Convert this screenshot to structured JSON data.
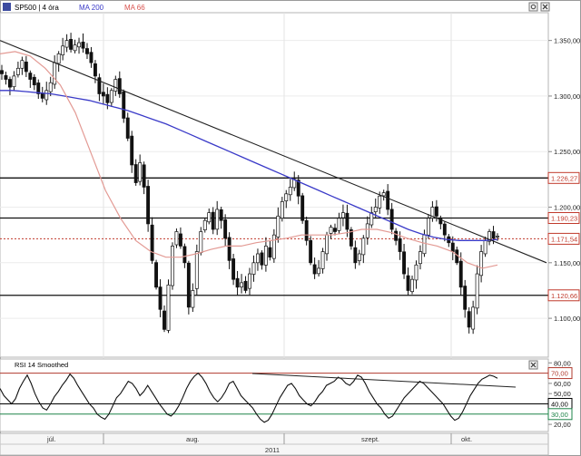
{
  "header": {
    "symbol": "SP500 | 4 óra",
    "ma200": "MA 200",
    "ma66": "MA 66",
    "colors": {
      "ma200": "#3a3ac8",
      "ma66": "#d9534f",
      "price": "#000000"
    }
  },
  "rsi_header": {
    "label": "RSI 14 Smoothed"
  },
  "time_axis": {
    "months": [
      "júl.",
      "aug.",
      "szept.",
      "okt."
    ],
    "year": "2011"
  },
  "icons": {
    "settings": "gear-icon",
    "close": "close-icon"
  },
  "chart_data": [
    {
      "type": "candlestick",
      "title": "SP500 | 4 óra",
      "ylim": [
        1065,
        1375
      ],
      "yticks": [
        "1.350,00",
        "1.300,00",
        "1.250,00",
        "1.200,00",
        "1.150,00",
        "1.100,00"
      ],
      "ytick_values": [
        1350,
        1300,
        1250,
        1200,
        1150,
        1100
      ],
      "levels": [
        {
          "label": "1.226,27",
          "value": 1226.27,
          "color": "#c0392b",
          "style": "solid"
        },
        {
          "label": "1.190,23",
          "value": 1190.23,
          "color": "#c0392b",
          "style": "solid"
        },
        {
          "label": "1.171,54",
          "value": 1171.54,
          "color": "#c0392b",
          "style": "dotted"
        },
        {
          "label": "1.120,66",
          "value": 1120.66,
          "color": "#c0392b",
          "style": "solid"
        }
      ],
      "price_close": [
        1320,
        1315,
        1308,
        1318,
        1325,
        1332,
        1322,
        1315,
        1310,
        1302,
        1298,
        1305,
        1312,
        1330,
        1338,
        1345,
        1350,
        1342,
        1346,
        1348,
        1343,
        1338,
        1330,
        1318,
        1302,
        1300,
        1294,
        1305,
        1315,
        1302,
        1280,
        1262,
        1238,
        1222,
        1240,
        1218,
        1185,
        1152,
        1128,
        1108,
        1090,
        1130,
        1165,
        1178,
        1165,
        1150,
        1110,
        1125,
        1160,
        1178,
        1188,
        1195,
        1180,
        1198,
        1188,
        1172,
        1152,
        1135,
        1128,
        1132,
        1125,
        1140,
        1150,
        1158,
        1148,
        1165,
        1155,
        1175,
        1192,
        1205,
        1212,
        1218,
        1225,
        1210,
        1188,
        1170,
        1150,
        1140,
        1145,
        1160,
        1175,
        1182,
        1178,
        1190,
        1195,
        1180,
        1165,
        1150,
        1158,
        1172,
        1185,
        1195,
        1200,
        1210,
        1213,
        1198,
        1180,
        1170,
        1160,
        1140,
        1125,
        1135,
        1148,
        1160,
        1175,
        1190,
        1200,
        1192,
        1185,
        1175,
        1168,
        1160,
        1150,
        1128,
        1108,
        1092,
        1110,
        1140,
        1160,
        1170,
        1178,
        1172,
        1174
      ],
      "ma200": [
        1305,
        1305,
        1304,
        1303,
        1302,
        1300,
        1298,
        1296,
        1293,
        1290,
        1287,
        1283,
        1279,
        1275,
        1270,
        1265,
        1260,
        1255,
        1250,
        1245,
        1240,
        1235,
        1230,
        1225,
        1220,
        1215,
        1210,
        1205,
        1200,
        1195,
        1190,
        1185,
        1180,
        1176,
        1173,
        1171,
        1170,
        1170,
        1170,
        1171
      ],
      "ma66": [
        1338,
        1340,
        1336,
        1325,
        1310,
        1285,
        1250,
        1215,
        1190,
        1170,
        1160,
        1155,
        1155,
        1158,
        1162,
        1165,
        1165,
        1168,
        1170,
        1172,
        1175,
        1175,
        1175,
        1177,
        1180,
        1180,
        1177,
        1172,
        1168,
        1165,
        1160,
        1150,
        1145,
        1148
      ],
      "trendline": {
        "from": 1350,
        "to": 1150
      }
    },
    {
      "type": "line",
      "title": "RSI 14 Smoothed",
      "ylim": [
        13,
        82
      ],
      "yticks": [
        "80,00",
        "60,00",
        "50,00",
        "40,00",
        "20,00"
      ],
      "ytick_values": [
        80,
        60,
        50,
        40,
        20
      ],
      "levels": [
        {
          "label": "70,00",
          "value": 70,
          "color": "#b03a2e"
        },
        {
          "label": "40,00",
          "value": 40,
          "color": "#000000"
        },
        {
          "label": "30,00",
          "value": 30,
          "color": "#1e8449"
        }
      ],
      "rsi": [
        55,
        48,
        44,
        40,
        45,
        55,
        62,
        68,
        60,
        50,
        42,
        36,
        34,
        40,
        47,
        52,
        58,
        63,
        69,
        65,
        58,
        52,
        46,
        40,
        36,
        30,
        27,
        25,
        30,
        38,
        46,
        50,
        56,
        62,
        60,
        55,
        48,
        52,
        58,
        52,
        46,
        40,
        35,
        30,
        28,
        32,
        38,
        46,
        55,
        62,
        67,
        70,
        66,
        60,
        52,
        46,
        42,
        46,
        52,
        60,
        62,
        55,
        48,
        44,
        40,
        36,
        30,
        25,
        22,
        24,
        30,
        38,
        46,
        52,
        58,
        60,
        55,
        48,
        44,
        40,
        38,
        42,
        48,
        52,
        58,
        60,
        62,
        66,
        64,
        60,
        58,
        62,
        68,
        66,
        60,
        52,
        46,
        40,
        36,
        30,
        26,
        28,
        34,
        40,
        46,
        50,
        54,
        58,
        62,
        60,
        56,
        52,
        48,
        44,
        40,
        34,
        28,
        24,
        26,
        32,
        40,
        48,
        54,
        60,
        64,
        66,
        68,
        67,
        65
      ]
    }
  ]
}
